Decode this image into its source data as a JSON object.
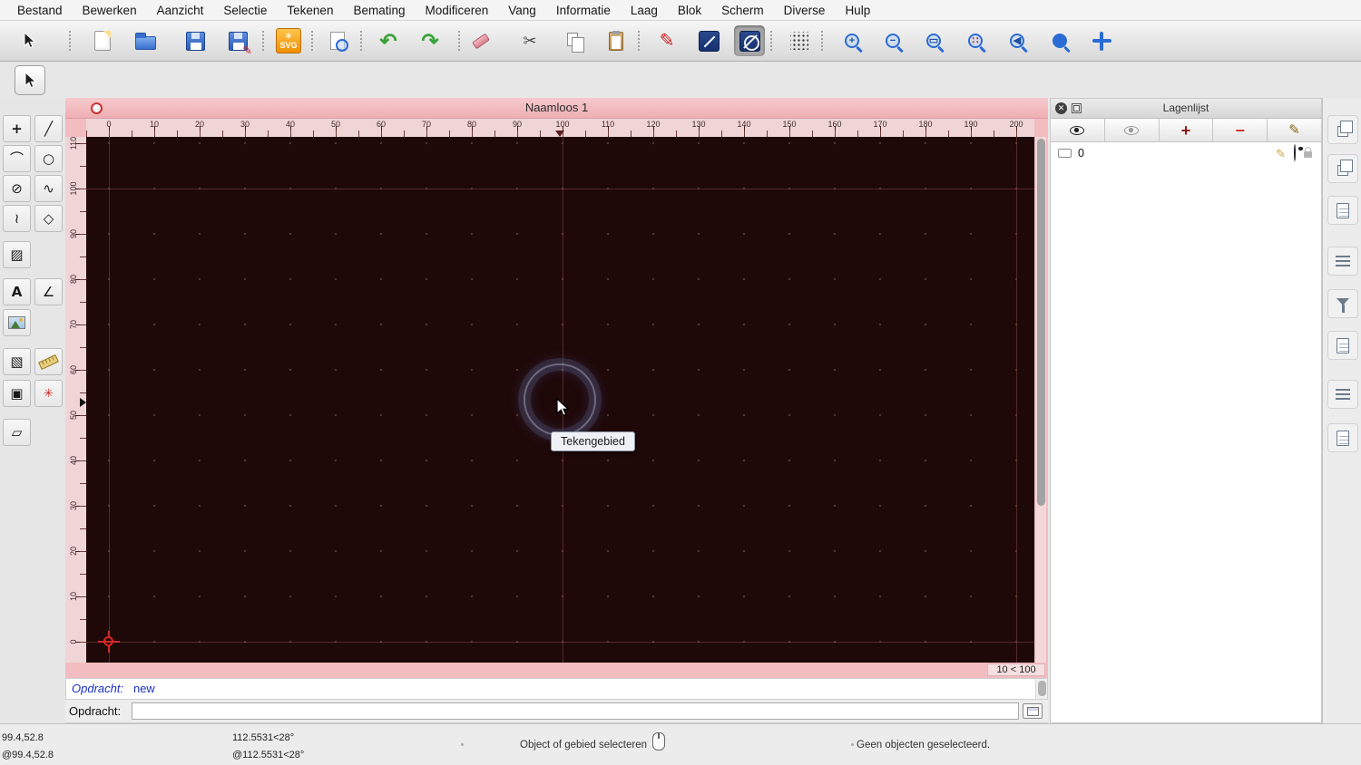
{
  "menu": {
    "items": [
      "Bestand",
      "Bewerken",
      "Aanzicht",
      "Selectie",
      "Tekenen",
      "Bemating",
      "Modificeren",
      "Vang",
      "Informatie",
      "Laag",
      "Blok",
      "Scherm",
      "Diverse",
      "Hulp"
    ]
  },
  "toolbar": {
    "svg_badge": "SVG"
  },
  "icons": {
    "undo": "↶",
    "redo": "↷",
    "cut": "✂",
    "pen": "✎",
    "save_pencil": "✎",
    "zoom_plus": "+",
    "zoom_minus": "−",
    "zoom_auto": "▭",
    "zoom_sel": "∷",
    "zoom_prev": "◀",
    "point": "+",
    "line": "╱",
    "arc": "⌒",
    "circle": "○",
    "ellipse": "⊘",
    "spline": "∿",
    "polyline": "≀",
    "polygon": "◇",
    "hatch": "▨",
    "text": "A",
    "dimension": "∠",
    "hatch2": "▧",
    "combine": "▣",
    "explode": "✳",
    "box3d": "▱",
    "panel_plus": "+",
    "panel_minus": "−",
    "layer_pencil": "✎",
    "row_pencil": "✎"
  },
  "window": {
    "title": "Naamloos 1",
    "grid_status": "10 < 100",
    "tooltip": "Tekengebied",
    "h_ruler": [
      "0",
      "10",
      "20",
      "30",
      "40",
      "50",
      "60",
      "70",
      "80",
      "90",
      "100",
      "110",
      "120",
      "130",
      "140",
      "150",
      "160",
      "170",
      "180",
      "190",
      "200"
    ],
    "v_ruler": [
      "110",
      "100",
      "90",
      "80",
      "70",
      "60",
      "50",
      "40",
      "30",
      "20",
      "10",
      "0"
    ]
  },
  "layer_panel": {
    "title": "Lagenlijst",
    "layers": [
      {
        "name": "0"
      }
    ]
  },
  "command": {
    "history_label": "Opdracht:",
    "history_value": "new",
    "prompt_label": "Opdracht:",
    "input_value": ""
  },
  "status": {
    "abs_coord": "99.4,52.8",
    "rel_coord": "@99.4,52.8",
    "abs_polar": "112.5531<28°",
    "rel_polar": "@112.5531<28°",
    "hint": "Object of gebied selecteren",
    "selection": "Geen objecten geselecteerd."
  },
  "colors": {
    "canvas_bg": "#1e0808",
    "window_frame": "#f2bcc0",
    "accent_blue": "#2b6cd4",
    "alert_red": "#cc2222"
  }
}
